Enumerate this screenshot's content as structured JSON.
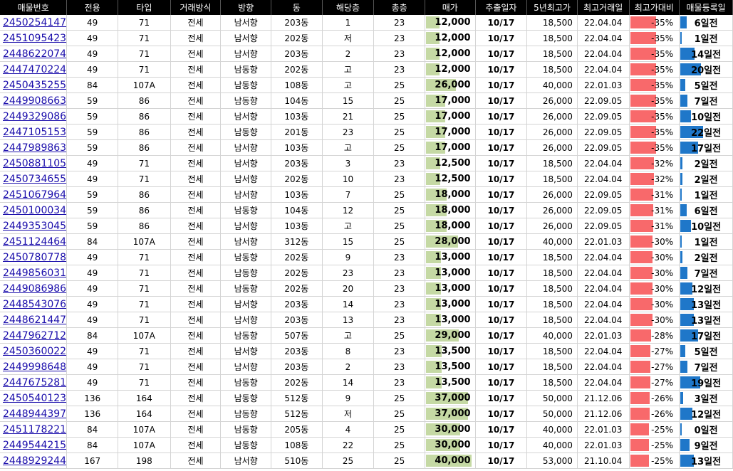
{
  "headers": [
    "매물번호",
    "전용",
    "타입",
    "거래방식",
    "방향",
    "동",
    "해당층",
    "총층",
    "매가",
    "추출일자",
    "5년최고가",
    "최고거래일",
    "최고가대비",
    "매물등록일"
  ],
  "colors": {
    "header_bg": "#000000",
    "price_bar": "#c5d9a4",
    "pct_bar": "#f8696b",
    "days_bar": "#1f77c9",
    "link": "#1a0dab"
  },
  "rows": [
    {
      "id": "2450254147",
      "area": "49",
      "type": "71",
      "trade": "전세",
      "dir": "남서향",
      "dong": "203동",
      "floor": "1",
      "total": "23",
      "price": "12,000",
      "price_num": 12000,
      "date": "10/17",
      "max5": "18,500",
      "maxdate": "22.04.04",
      "pct": "-35%",
      "pct_num": 35,
      "days": "6일전",
      "days_num": 6
    },
    {
      "id": "2451095423",
      "area": "49",
      "type": "71",
      "trade": "전세",
      "dir": "남서향",
      "dong": "202동",
      "floor": "저",
      "total": "23",
      "price": "12,000",
      "price_num": 12000,
      "date": "10/17",
      "max5": "18,500",
      "maxdate": "22.04.04",
      "pct": "-35%",
      "pct_num": 35,
      "days": "1일전",
      "days_num": 1
    },
    {
      "id": "2448622074",
      "area": "49",
      "type": "71",
      "trade": "전세",
      "dir": "남서향",
      "dong": "203동",
      "floor": "2",
      "total": "23",
      "price": "12,000",
      "price_num": 12000,
      "date": "10/17",
      "max5": "18,500",
      "maxdate": "22.04.04",
      "pct": "-35%",
      "pct_num": 35,
      "days": "14일전",
      "days_num": 14
    },
    {
      "id": "2447470224",
      "area": "49",
      "type": "71",
      "trade": "전세",
      "dir": "남동향",
      "dong": "202동",
      "floor": "고",
      "total": "23",
      "price": "12,000",
      "price_num": 12000,
      "date": "10/17",
      "max5": "18,500",
      "maxdate": "22.04.04",
      "pct": "-35%",
      "pct_num": 35,
      "days": "20일전",
      "days_num": 20
    },
    {
      "id": "2450435255",
      "area": "84",
      "type": "107A",
      "trade": "전세",
      "dir": "남동향",
      "dong": "108동",
      "floor": "고",
      "total": "25",
      "price": "26,000",
      "price_num": 26000,
      "date": "10/17",
      "max5": "40,000",
      "maxdate": "22.01.03",
      "pct": "-35%",
      "pct_num": 35,
      "days": "5일전",
      "days_num": 5
    },
    {
      "id": "2449908663",
      "area": "59",
      "type": "86",
      "trade": "전세",
      "dir": "남동향",
      "dong": "104동",
      "floor": "15",
      "total": "25",
      "price": "17,000",
      "price_num": 17000,
      "date": "10/17",
      "max5": "26,000",
      "maxdate": "22.09.05",
      "pct": "-35%",
      "pct_num": 35,
      "days": "7일전",
      "days_num": 7
    },
    {
      "id": "2449329086",
      "area": "59",
      "type": "86",
      "trade": "전세",
      "dir": "남서향",
      "dong": "103동",
      "floor": "21",
      "total": "25",
      "price": "17,000",
      "price_num": 17000,
      "date": "10/17",
      "max5": "26,000",
      "maxdate": "22.09.05",
      "pct": "-35%",
      "pct_num": 35,
      "days": "10일전",
      "days_num": 10
    },
    {
      "id": "2447105153",
      "area": "59",
      "type": "86",
      "trade": "전세",
      "dir": "남동향",
      "dong": "201동",
      "floor": "23",
      "total": "25",
      "price": "17,000",
      "price_num": 17000,
      "date": "10/17",
      "max5": "26,000",
      "maxdate": "22.09.05",
      "pct": "-35%",
      "pct_num": 35,
      "days": "22일전",
      "days_num": 22
    },
    {
      "id": "2447989863",
      "area": "59",
      "type": "86",
      "trade": "전세",
      "dir": "남서향",
      "dong": "103동",
      "floor": "고",
      "total": "25",
      "price": "17,000",
      "price_num": 17000,
      "date": "10/17",
      "max5": "26,000",
      "maxdate": "22.09.05",
      "pct": "-35%",
      "pct_num": 35,
      "days": "17일전",
      "days_num": 17
    },
    {
      "id": "2450881105",
      "area": "49",
      "type": "71",
      "trade": "전세",
      "dir": "남서향",
      "dong": "203동",
      "floor": "3",
      "total": "23",
      "price": "12,500",
      "price_num": 12500,
      "date": "10/17",
      "max5": "18,500",
      "maxdate": "22.04.04",
      "pct": "-32%",
      "pct_num": 32,
      "days": "2일전",
      "days_num": 2
    },
    {
      "id": "2450734655",
      "area": "49",
      "type": "71",
      "trade": "전세",
      "dir": "남서향",
      "dong": "202동",
      "floor": "10",
      "total": "23",
      "price": "12,500",
      "price_num": 12500,
      "date": "10/17",
      "max5": "18,500",
      "maxdate": "22.04.04",
      "pct": "-32%",
      "pct_num": 32,
      "days": "2일전",
      "days_num": 2
    },
    {
      "id": "2451067964",
      "area": "59",
      "type": "86",
      "trade": "전세",
      "dir": "남서향",
      "dong": "103동",
      "floor": "7",
      "total": "25",
      "price": "18,000",
      "price_num": 18000,
      "date": "10/17",
      "max5": "26,000",
      "maxdate": "22.09.05",
      "pct": "-31%",
      "pct_num": 31,
      "days": "1일전",
      "days_num": 1
    },
    {
      "id": "2450100034",
      "area": "59",
      "type": "86",
      "trade": "전세",
      "dir": "남동향",
      "dong": "104동",
      "floor": "12",
      "total": "25",
      "price": "18,000",
      "price_num": 18000,
      "date": "10/17",
      "max5": "26,000",
      "maxdate": "22.09.05",
      "pct": "-31%",
      "pct_num": 31,
      "days": "6일전",
      "days_num": 6
    },
    {
      "id": "2449353045",
      "area": "59",
      "type": "86",
      "trade": "전세",
      "dir": "남서향",
      "dong": "103동",
      "floor": "고",
      "total": "25",
      "price": "18,000",
      "price_num": 18000,
      "date": "10/17",
      "max5": "26,000",
      "maxdate": "22.09.05",
      "pct": "-31%",
      "pct_num": 31,
      "days": "10일전",
      "days_num": 10
    },
    {
      "id": "2451124464",
      "area": "84",
      "type": "107A",
      "trade": "전세",
      "dir": "남서향",
      "dong": "312동",
      "floor": "15",
      "total": "25",
      "price": "28,000",
      "price_num": 28000,
      "date": "10/17",
      "max5": "40,000",
      "maxdate": "22.01.03",
      "pct": "-30%",
      "pct_num": 30,
      "days": "1일전",
      "days_num": 1
    },
    {
      "id": "2450780778",
      "area": "49",
      "type": "71",
      "trade": "전세",
      "dir": "남동향",
      "dong": "202동",
      "floor": "9",
      "total": "23",
      "price": "13,000",
      "price_num": 13000,
      "date": "10/17",
      "max5": "18,500",
      "maxdate": "22.04.04",
      "pct": "-30%",
      "pct_num": 30,
      "days": "2일전",
      "days_num": 2
    },
    {
      "id": "2449856031",
      "area": "49",
      "type": "71",
      "trade": "전세",
      "dir": "남동향",
      "dong": "202동",
      "floor": "23",
      "total": "23",
      "price": "13,000",
      "price_num": 13000,
      "date": "10/17",
      "max5": "18,500",
      "maxdate": "22.04.04",
      "pct": "-30%",
      "pct_num": 30,
      "days": "7일전",
      "days_num": 7
    },
    {
      "id": "2449086986",
      "area": "49",
      "type": "71",
      "trade": "전세",
      "dir": "남동향",
      "dong": "202동",
      "floor": "20",
      "total": "23",
      "price": "13,000",
      "price_num": 13000,
      "date": "10/17",
      "max5": "18,500",
      "maxdate": "22.04.04",
      "pct": "-30%",
      "pct_num": 30,
      "days": "12일전",
      "days_num": 12
    },
    {
      "id": "2448543076",
      "area": "49",
      "type": "71",
      "trade": "전세",
      "dir": "남서향",
      "dong": "203동",
      "floor": "14",
      "total": "23",
      "price": "13,000",
      "price_num": 13000,
      "date": "10/17",
      "max5": "18,500",
      "maxdate": "22.04.04",
      "pct": "-30%",
      "pct_num": 30,
      "days": "13일전",
      "days_num": 13
    },
    {
      "id": "2448621447",
      "area": "49",
      "type": "71",
      "trade": "전세",
      "dir": "남서향",
      "dong": "203동",
      "floor": "13",
      "total": "23",
      "price": "13,000",
      "price_num": 13000,
      "date": "10/17",
      "max5": "18,500",
      "maxdate": "22.04.04",
      "pct": "-30%",
      "pct_num": 30,
      "days": "13일전",
      "days_num": 13
    },
    {
      "id": "2447962712",
      "area": "84",
      "type": "107A",
      "trade": "전세",
      "dir": "남동향",
      "dong": "507동",
      "floor": "고",
      "total": "25",
      "price": "29,000",
      "price_num": 29000,
      "date": "10/17",
      "max5": "40,000",
      "maxdate": "22.01.03",
      "pct": "-28%",
      "pct_num": 28,
      "days": "17일전",
      "days_num": 17
    },
    {
      "id": "2450360022",
      "area": "49",
      "type": "71",
      "trade": "전세",
      "dir": "남서향",
      "dong": "203동",
      "floor": "8",
      "total": "23",
      "price": "13,500",
      "price_num": 13500,
      "date": "10/17",
      "max5": "18,500",
      "maxdate": "22.04.04",
      "pct": "-27%",
      "pct_num": 27,
      "days": "5일전",
      "days_num": 5
    },
    {
      "id": "2449998648",
      "area": "49",
      "type": "71",
      "trade": "전세",
      "dir": "남서향",
      "dong": "203동",
      "floor": "2",
      "total": "23",
      "price": "13,500",
      "price_num": 13500,
      "date": "10/17",
      "max5": "18,500",
      "maxdate": "22.04.04",
      "pct": "-27%",
      "pct_num": 27,
      "days": "7일전",
      "days_num": 7
    },
    {
      "id": "2447675281",
      "area": "49",
      "type": "71",
      "trade": "전세",
      "dir": "남동향",
      "dong": "202동",
      "floor": "14",
      "total": "23",
      "price": "13,500",
      "price_num": 13500,
      "date": "10/17",
      "max5": "18,500",
      "maxdate": "22.04.04",
      "pct": "-27%",
      "pct_num": 27,
      "days": "19일전",
      "days_num": 19
    },
    {
      "id": "2450540123",
      "area": "136",
      "type": "164",
      "trade": "전세",
      "dir": "남동향",
      "dong": "512동",
      "floor": "9",
      "total": "25",
      "price": "37,000",
      "price_num": 37000,
      "date": "10/17",
      "max5": "50,000",
      "maxdate": "21.12.06",
      "pct": "-26%",
      "pct_num": 26,
      "days": "3일전",
      "days_num": 3
    },
    {
      "id": "2448944397",
      "area": "136",
      "type": "164",
      "trade": "전세",
      "dir": "남동향",
      "dong": "512동",
      "floor": "저",
      "total": "25",
      "price": "37,000",
      "price_num": 37000,
      "date": "10/17",
      "max5": "50,000",
      "maxdate": "21.12.06",
      "pct": "-26%",
      "pct_num": 26,
      "days": "12일전",
      "days_num": 12
    },
    {
      "id": "2451178221",
      "area": "84",
      "type": "107A",
      "trade": "전세",
      "dir": "남동향",
      "dong": "205동",
      "floor": "4",
      "total": "25",
      "price": "30,000",
      "price_num": 30000,
      "date": "10/17",
      "max5": "40,000",
      "maxdate": "22.01.03",
      "pct": "-25%",
      "pct_num": 25,
      "days": "0일전",
      "days_num": 0
    },
    {
      "id": "2449544215",
      "area": "84",
      "type": "107A",
      "trade": "전세",
      "dir": "남동향",
      "dong": "108동",
      "floor": "22",
      "total": "25",
      "price": "30,000",
      "price_num": 30000,
      "date": "10/17",
      "max5": "40,000",
      "maxdate": "22.01.03",
      "pct": "-25%",
      "pct_num": 25,
      "days": "9일전",
      "days_num": 9
    },
    {
      "id": "2448929244",
      "area": "167",
      "type": "198",
      "trade": "전세",
      "dir": "남서향",
      "dong": "510동",
      "floor": "25",
      "total": "25",
      "price": "40,000",
      "price_num": 40000,
      "date": "10/17",
      "max5": "53,000",
      "maxdate": "21.10.04",
      "pct": "-25%",
      "pct_num": 25,
      "days": "13일전",
      "days_num": 13
    }
  ]
}
